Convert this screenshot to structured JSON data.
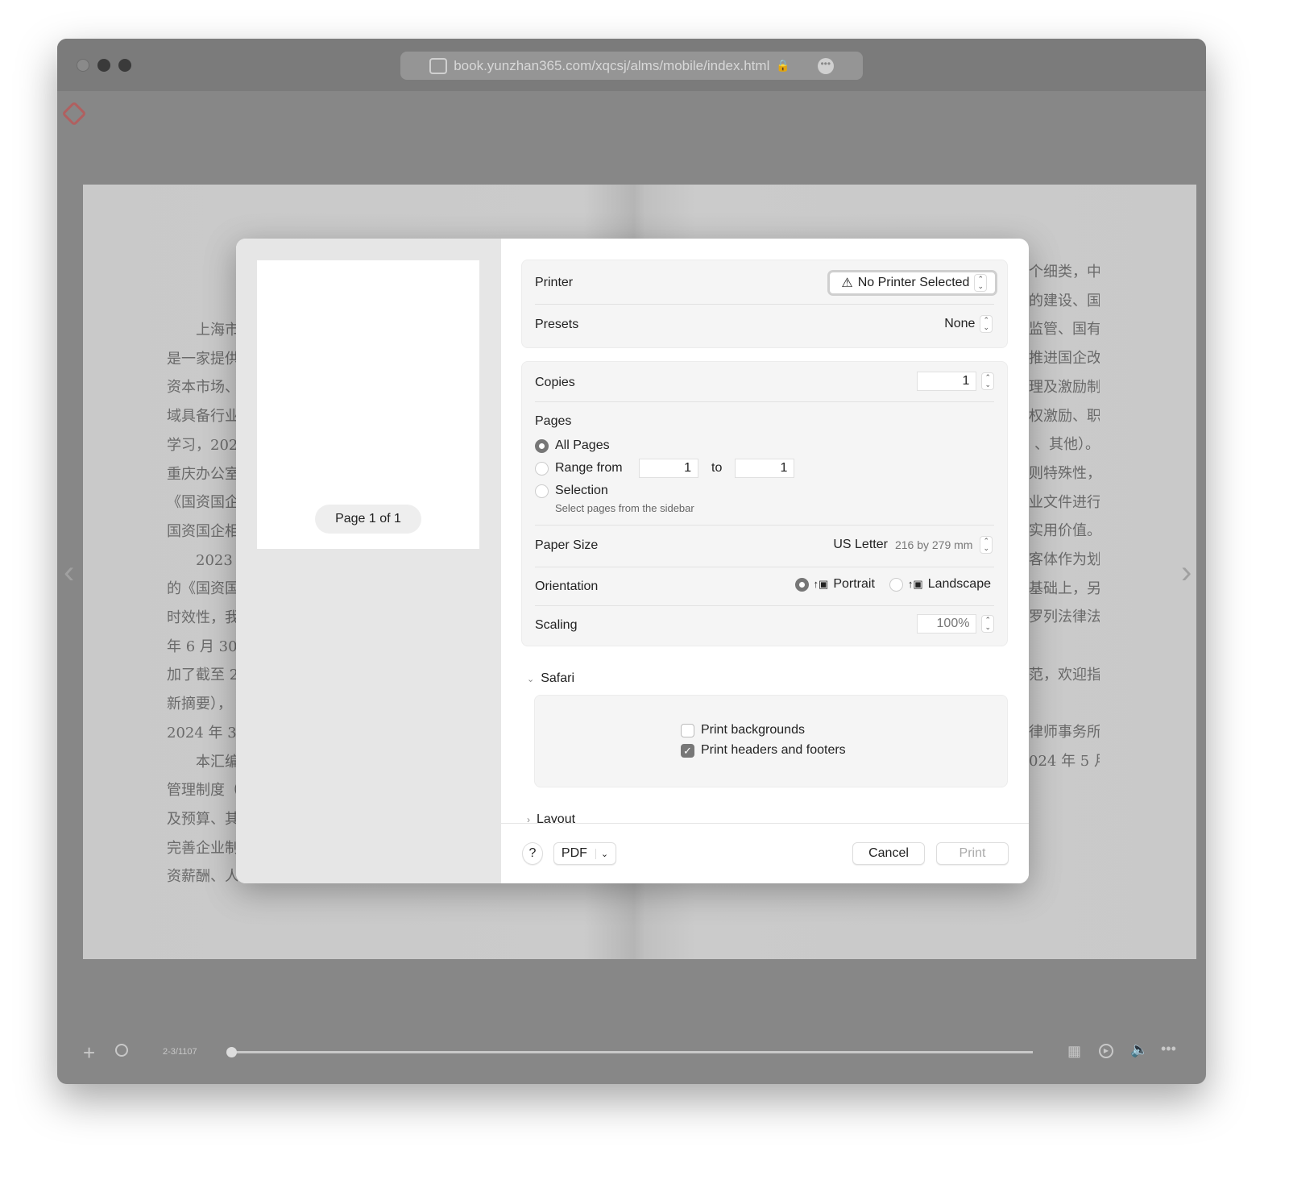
{
  "browser": {
    "url": "book.yunzhan365.com/xqcsj/alms/mobile/index.html"
  },
  "book": {
    "left_lines": [
      "　　上海市",
      "是一家提供",
      "资本市场、",
      "域具备行业",
      "学习，202",
      "重庆办公室",
      "《国资国企",
      "国资国企相",
      "　　2023 年",
      "的《国资国",
      "时效性，我",
      "年 6 月 30",
      "加了截至 2",
      "新摘要），",
      "2024 年 3 ",
      "　　本汇编",
      "管理制度（",
      "及预算、其",
      "完善企业制",
      "资薪酬、人"
    ],
    "right_lines": [
      "个细类，中",
      "的建设、国",
      "监管、国有",
      "推进国企改",
      "理及激励制",
      "权激励、职",
      "、其他）。",
      "则特殊性，",
      "业文件进行",
      "实用价值。",
      "客体作为划",
      "基础上，另",
      "罗列法律法",
      "",
      "范，欢迎指",
      "",
      "律师事务所",
      "024 年 5 月"
    ]
  },
  "toolbar": {
    "page_indicator": "2-3/1107",
    "progress_fraction": 0.0
  },
  "print_dialog": {
    "preview": {
      "page_label": "Page 1 of 1"
    },
    "printer": {
      "label": "Printer",
      "value": "No Printer Selected"
    },
    "presets": {
      "label": "Presets",
      "value": "None"
    },
    "copies": {
      "label": "Copies",
      "value": "1"
    },
    "pages": {
      "label": "Pages",
      "all": "All Pages",
      "range": "Range from",
      "range_from": "1",
      "to": "to",
      "range_to": "1",
      "selection": "Selection",
      "selection_hint": "Select pages from the sidebar",
      "selected": "All Pages"
    },
    "paper_size": {
      "label": "Paper Size",
      "value": "US Letter",
      "dimensions": "216 by 279 mm"
    },
    "orientation": {
      "label": "Orientation",
      "portrait": "Portrait",
      "landscape": "Landscape",
      "selected": "Portrait"
    },
    "scaling": {
      "label": "Scaling",
      "value": "100%"
    },
    "safari": {
      "label": "Safari",
      "print_backgrounds": "Print backgrounds",
      "print_backgrounds_checked": false,
      "print_headers": "Print headers and footers",
      "print_headers_checked": true
    },
    "layout": {
      "label": "Layout"
    },
    "footer": {
      "help": "?",
      "pdf": "PDF",
      "cancel": "Cancel",
      "print": "Print"
    }
  }
}
